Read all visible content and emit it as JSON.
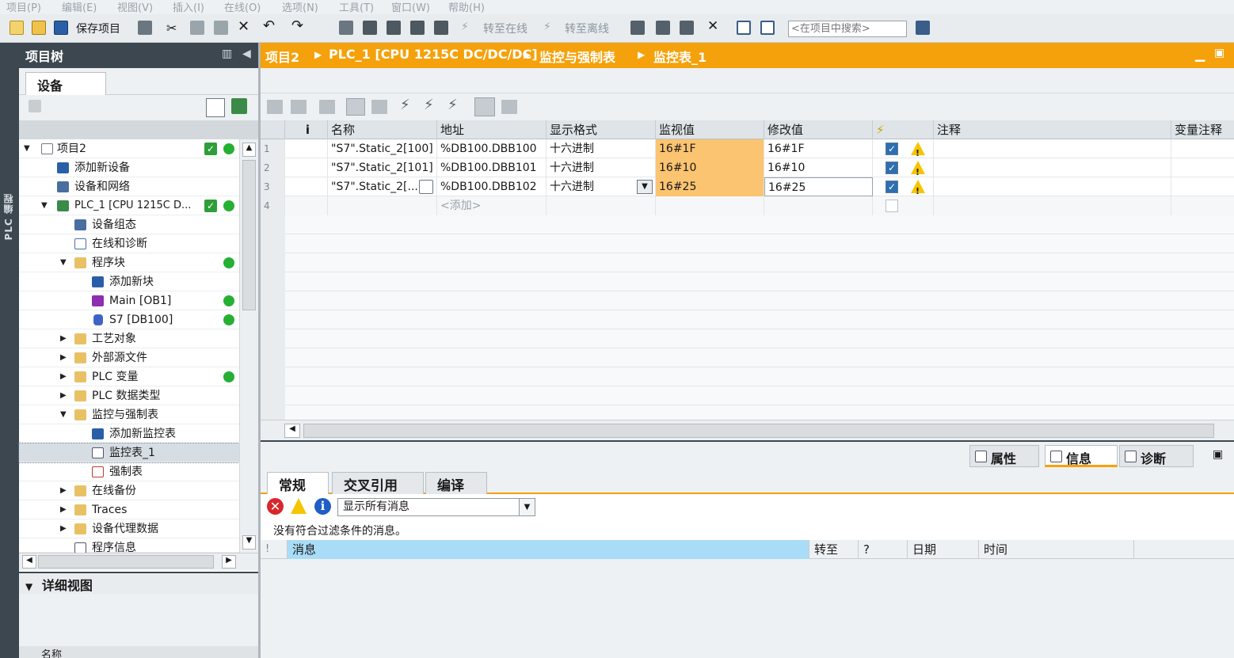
{
  "menu": [
    "项目(P)",
    "编辑(E)",
    "视图(V)",
    "插入(I)",
    "在线(O)",
    "选项(N)",
    "工具(T)",
    "窗口(W)",
    "帮助(H)"
  ],
  "toolbar": {
    "save_label": "保存项目",
    "go_online": "转至在线",
    "go_offline": "转至离线",
    "search_placeholder": "<在项目中搜索>"
  },
  "side_strip": {
    "label": "PLC 编程"
  },
  "project_tree": {
    "title": "项目树",
    "tab": "设备",
    "items": [
      {
        "label": "项目2",
        "status": "ok"
      },
      {
        "label": "添加新设备"
      },
      {
        "label": "设备和网络"
      },
      {
        "label": "PLC_1 [CPU 1215C D...",
        "status": "ok"
      },
      {
        "label": "设备组态"
      },
      {
        "label": "在线和诊断"
      },
      {
        "label": "程序块"
      },
      {
        "label": "添加新块"
      },
      {
        "label": "Main [OB1]"
      },
      {
        "label": "S7 [DB100]"
      },
      {
        "label": "工艺对象"
      },
      {
        "label": "外部源文件"
      },
      {
        "label": "PLC 变量"
      },
      {
        "label": "PLC 数据类型"
      },
      {
        "label": "监控与强制表"
      },
      {
        "label": "添加新监控表"
      },
      {
        "label": "监控表_1"
      },
      {
        "label": "强制表"
      },
      {
        "label": "在线备份"
      },
      {
        "label": "Traces"
      },
      {
        "label": "设备代理数据"
      },
      {
        "label": "程序信息"
      }
    ]
  },
  "detail_view": {
    "title": "详细视图",
    "col_name": "名称"
  },
  "breadcrumb": [
    "项目2",
    "PLC_1 [CPU 1215C DC/DC/DC]",
    "监控与强制表",
    "监控表_1"
  ],
  "watch_table": {
    "headers": {
      "i": "i",
      "name": "名称",
      "address": "地址",
      "format": "显示格式",
      "monitor": "监视值",
      "modify": "修改值",
      "flash": "⚡",
      "comment": "注释",
      "var_comment": "变量注释"
    },
    "rows": [
      {
        "n": "1",
        "name": "\"S7\".Static_2[100]",
        "address": "%DB100.DBB100",
        "format": "十六进制",
        "monitor": "16#1F",
        "modify": "16#1F"
      },
      {
        "n": "2",
        "name": "\"S7\".Static_2[101]",
        "address": "%DB100.DBB101",
        "format": "十六进制",
        "monitor": "16#10",
        "modify": "16#10"
      },
      {
        "n": "3",
        "name": "\"S7\".Static_2[...",
        "address": "%DB100.DBB102",
        "format": "十六进制",
        "monitor": "16#25",
        "modify": "16#25"
      },
      {
        "n": "4",
        "name": "",
        "address": "<添加>",
        "format": "",
        "monitor": "",
        "modify": ""
      }
    ]
  },
  "inspector": {
    "tabs": [
      "属性",
      "信息",
      "诊断"
    ],
    "subtabs": [
      "常规",
      "交叉引用",
      "编译"
    ],
    "filter_value": "显示所有消息",
    "no_messages": "没有符合过滤条件的消息。",
    "msg_headers": [
      "!",
      "消息",
      "转至",
      "?",
      "日期",
      "时间"
    ]
  },
  "colors": {
    "accent": "#f5a10b",
    "dark": "#3d4750",
    "monitor_bg": "#fbc470",
    "ok_green": "#26b033"
  }
}
